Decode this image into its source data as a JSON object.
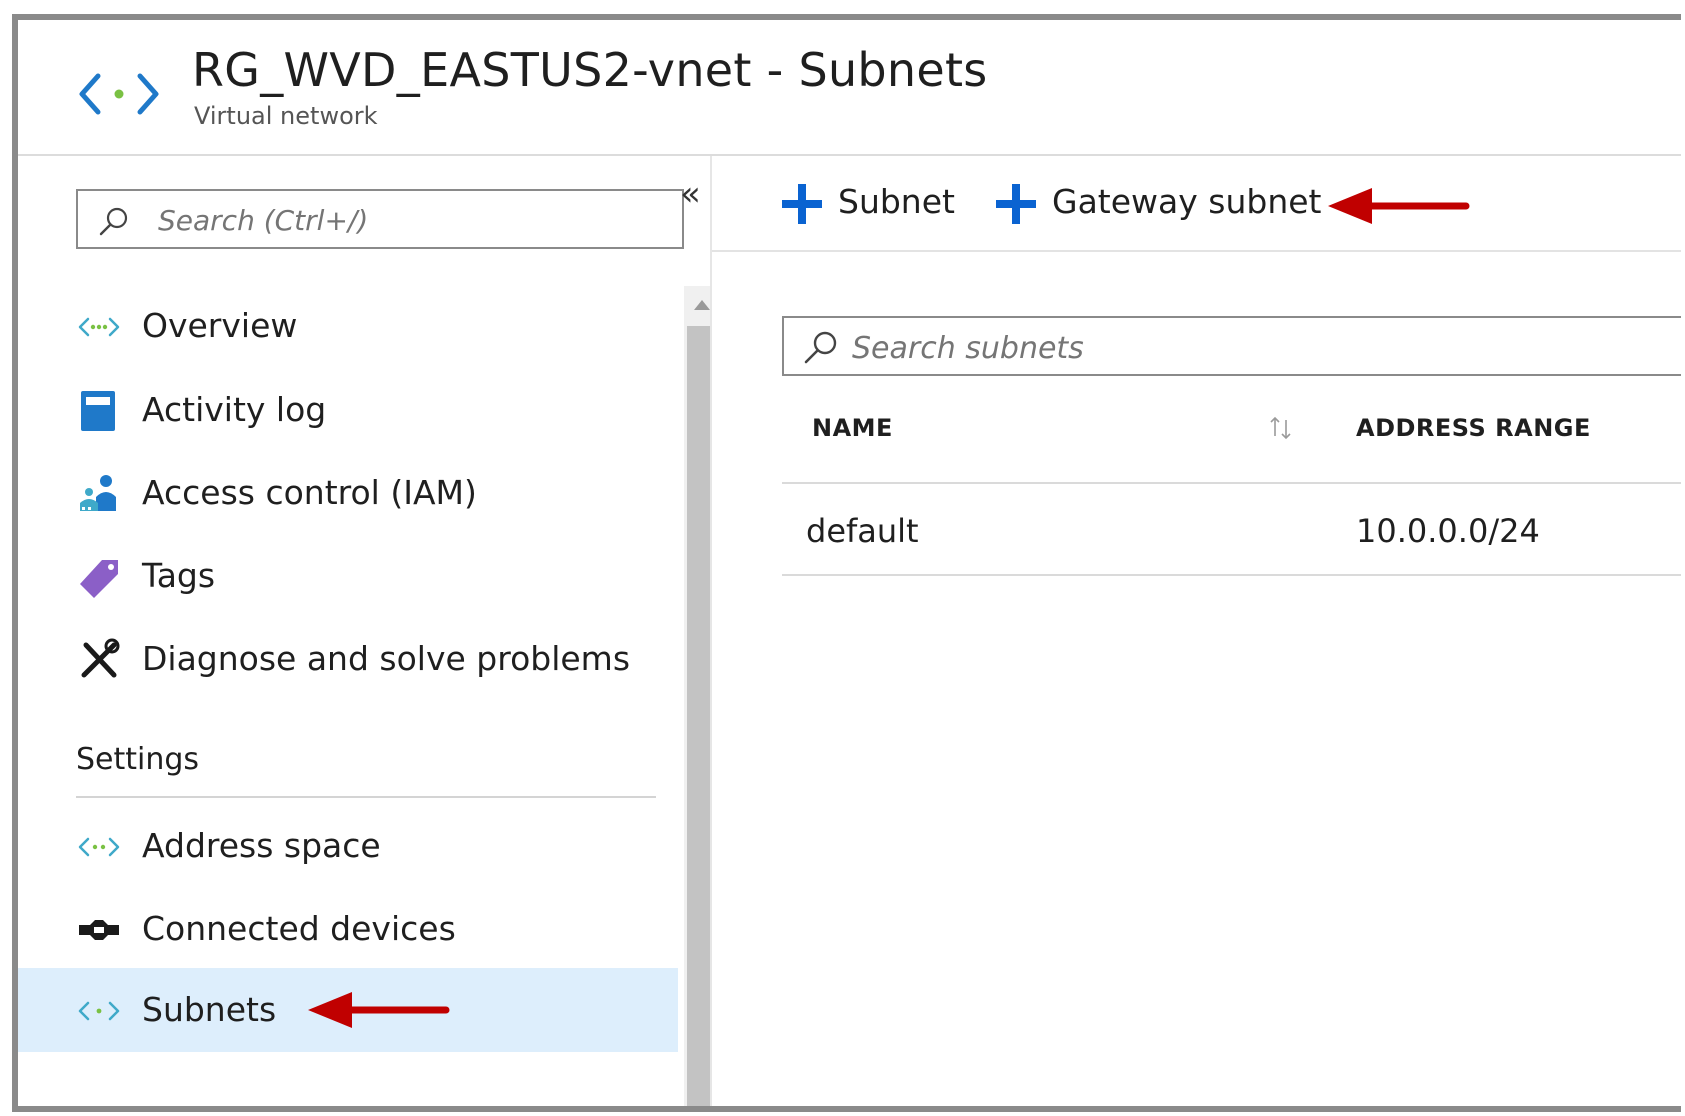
{
  "header": {
    "title": "RG_WVD_EASTUS2-vnet - Subnets",
    "subtitle": "Virtual network",
    "icon": "vnet-icon"
  },
  "left_pane": {
    "search_placeholder": "Search (Ctrl+/)",
    "collapse_label": "«",
    "items": [
      {
        "label": "Overview",
        "icon": "vnet-overview-icon"
      },
      {
        "label": "Activity log",
        "icon": "activity-log-icon"
      },
      {
        "label": "Access control (IAM)",
        "icon": "iam-icon"
      },
      {
        "label": "Tags",
        "icon": "tag-icon"
      },
      {
        "label": "Diagnose and solve problems",
        "icon": "tools-icon"
      }
    ],
    "section_settings": "Settings",
    "settings_items": [
      {
        "label": "Address space",
        "icon": "address-space-icon"
      },
      {
        "label": "Connected devices",
        "icon": "connected-devices-icon"
      },
      {
        "label": "Subnets",
        "icon": "subnets-icon",
        "selected": true
      }
    ]
  },
  "toolbar": {
    "subnet_label": "Subnet",
    "gateway_subnet_label": "Gateway subnet"
  },
  "subnets": {
    "search_placeholder": "Search subnets",
    "columns": [
      "NAME",
      "ADDRESS RANGE"
    ],
    "rows": [
      {
        "name": "default",
        "address_range": "10.0.0.0/24"
      }
    ]
  },
  "colors": {
    "accent_blue": "#0a63d1",
    "selected_bg": "#ddeefc",
    "arrow_red": "#c00000",
    "vnet_teal": "#3fa9c9"
  }
}
